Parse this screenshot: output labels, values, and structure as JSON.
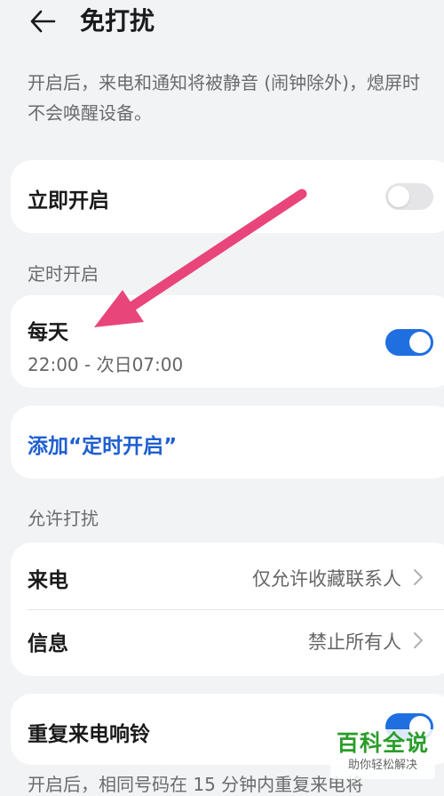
{
  "header": {
    "title": "免打扰",
    "back_icon": "arrow-left-icon"
  },
  "description": "开启后，来电和通知将被静音 (闹钟除外)，熄屏时不会唤醒设备。",
  "immediate": {
    "label": "立即开启",
    "enabled": false
  },
  "scheduled": {
    "section_title": "定时开启",
    "schedule_name": "每天",
    "schedule_time": "22:00 - 次日07:00",
    "enabled": true,
    "add_label": "添加“定时开启”"
  },
  "allow": {
    "section_title": "允许打扰",
    "items": [
      {
        "label": "来电",
        "value": "仅允许收藏联系人"
      },
      {
        "label": "信息",
        "value": "禁止所有人"
      }
    ]
  },
  "repeat_calls": {
    "label": "重复来电响铃",
    "enabled": true
  },
  "footnote": "开启后，相同号码在 15 分钟内重复来电将",
  "watermark": {
    "main": "百科全说",
    "sub": "助你轻松解决"
  },
  "colors": {
    "accent": "#1f6fe0",
    "link": "#1f5fd0",
    "arrow": "#e8457a",
    "background": "#f1f3f5",
    "card": "#ffffff",
    "watermark_green": "#2a9d2a"
  }
}
